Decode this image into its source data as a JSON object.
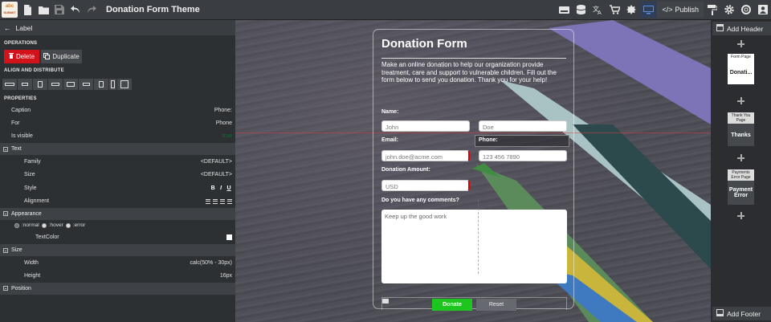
{
  "header": {
    "logo_line1": "abc",
    "logo_line2": "SUBMIT",
    "title": "Donation Form Theme",
    "publish_label": "Publish"
  },
  "left_panel": {
    "back_label": "Label",
    "operations_heading": "OPERATIONS",
    "delete_label": "Delete",
    "duplicate_label": "Duplicate",
    "align_heading": "ALIGN AND DISTRIBUTE",
    "properties_heading": "PROPERTIES",
    "props": {
      "caption_label": "Caption",
      "caption_value": "Phone:",
      "for_label": "For",
      "for_value": "Phone",
      "visible_label": "Is visible",
      "visible_value": "true"
    },
    "text_group": {
      "title": "Text",
      "family_label": "Family",
      "family_value": "<DEFAULT>",
      "size_label": "Size",
      "size_value": "<DEFAULT>",
      "style_label": "Style",
      "style_b": "B",
      "style_i": "I",
      "style_u": "U",
      "alignment_label": "Alignment"
    },
    "appearance_group": {
      "title": "Appearance",
      "state_normal": ":normal",
      "state_hover": ":hover",
      "state_error": ":error",
      "textcolor_label": "TextColor",
      "textcolor_value": "#ffffff"
    },
    "size_group": {
      "title": "Size",
      "width_label": "Width",
      "width_value": "calc(50% - 30px)",
      "height_label": "Height",
      "height_value": "16px"
    },
    "position_group": {
      "title": "Position"
    }
  },
  "form": {
    "title": "Donation Form",
    "description": "Make an online donation to help our organization provide treatment, care and support to vulnerable children. Fill out the form below to send you donation. Thank you for your help!",
    "name_label": "Name:",
    "first_name_placeholder": "John",
    "last_name_placeholder": "Doe",
    "email_label": "Email:",
    "email_placeholder": "john.doe@acme.com",
    "phone_label": "Phone:",
    "phone_placeholder": "123 456 7890",
    "amount_label": "Donation Amount:",
    "amount_placeholder": "USD",
    "comments_label": "Do you have any comments?",
    "comments_placeholder": "Keep up the good work",
    "donate_label": "Donate",
    "reset_label": "Reset"
  },
  "right_panel": {
    "add_header_label": "Add Header",
    "add_footer_label": "Add Footer",
    "pages": [
      {
        "caption": "Form Page",
        "name": "Donati..."
      },
      {
        "caption": "Thank You Page",
        "name": "Thanks"
      },
      {
        "caption": "Payments Error Page",
        "name": "Payment Error"
      }
    ]
  },
  "colors": {
    "delete": "#d3131b",
    "donate": "#1ec51e",
    "selection_guide": "#dc3c3c"
  }
}
